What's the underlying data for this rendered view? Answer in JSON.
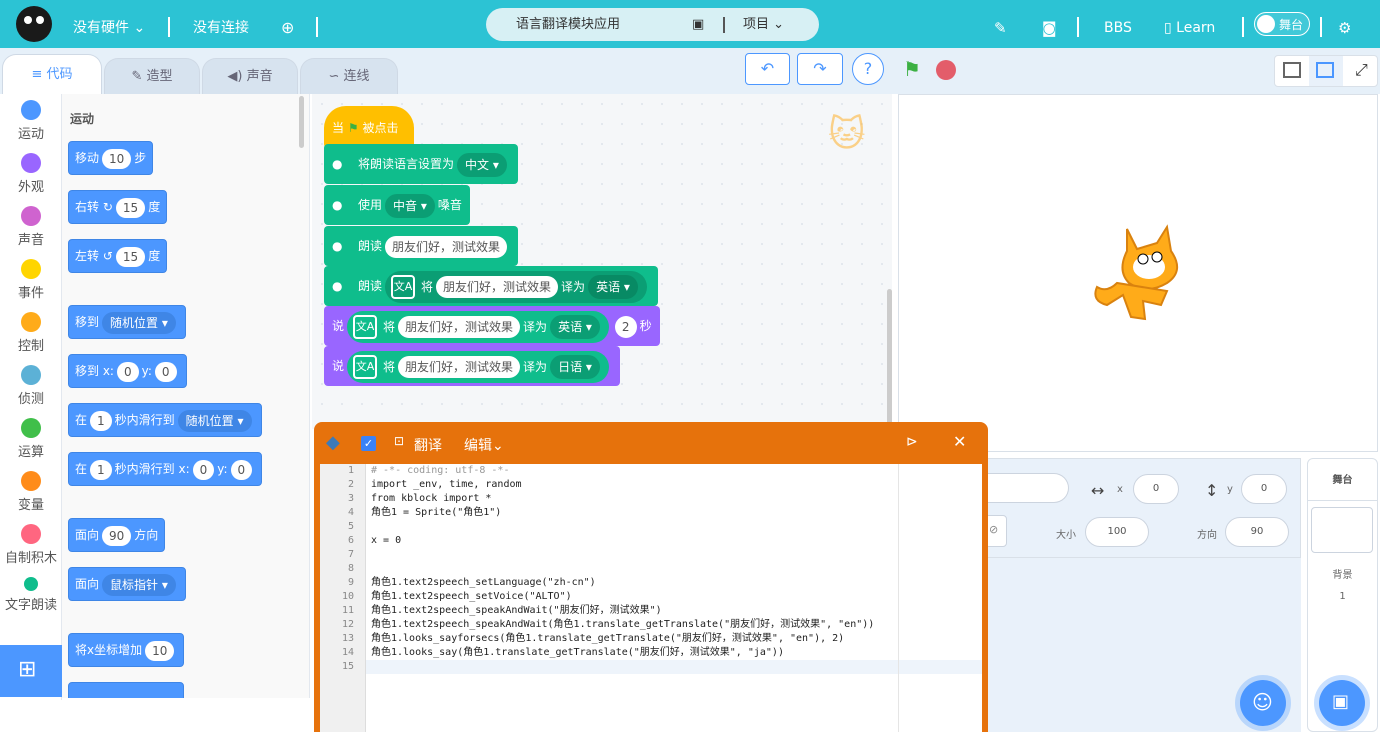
{
  "topbar": {
    "hardware": "没有硬件",
    "connection": "没有连接",
    "project_name": "语言翻译模块应用",
    "project_menu": "项目",
    "bbs": "BBS",
    "learn": "Learn",
    "stage_toggle": "舞台"
  },
  "tabs": [
    "代码",
    "造型",
    "声音",
    "连线"
  ],
  "categories": [
    {
      "label": "运动",
      "color": "#4c97ff"
    },
    {
      "label": "外观",
      "color": "#9966ff"
    },
    {
      "label": "声音",
      "color": "#cf63cf"
    },
    {
      "label": "事件",
      "color": "#ffd500"
    },
    {
      "label": "控制",
      "color": "#ffab19"
    },
    {
      "label": "侦测",
      "color": "#5cb1d6"
    },
    {
      "label": "运算",
      "color": "#40bf4a"
    },
    {
      "label": "变量",
      "color": "#ff8c1a"
    },
    {
      "label": "自制积木",
      "color": "#ff6680"
    },
    {
      "label": "文字朗读",
      "color": "#0fbd8c"
    }
  ],
  "palette": {
    "heading": "运动",
    "move": {
      "a": "移动",
      "v": "10",
      "b": "步"
    },
    "turn_right": {
      "a": "右转",
      "v": "15",
      "b": "度"
    },
    "turn_left": {
      "a": "左转",
      "v": "15",
      "b": "度"
    },
    "goto": {
      "a": "移到",
      "d": "随机位置"
    },
    "goto_xy": {
      "a": "移到 x:",
      "x": "0",
      "b": "y:",
      "y": "0"
    },
    "glide": {
      "a": "在",
      "v": "1",
      "b": "秒内滑行到",
      "d": "随机位置"
    },
    "glide_xy": {
      "a": "在",
      "v": "1",
      "b": "秒内滑行到 x:",
      "x": "0",
      "c": "y:",
      "y": "0"
    },
    "point": {
      "a": "面向",
      "v": "90",
      "b": "方向"
    },
    "point_towards": {
      "a": "面向",
      "d": "鼠标指针"
    },
    "change_x": {
      "a": "将x坐标增加",
      "v": "10"
    }
  },
  "script": {
    "hat": {
      "a": "当",
      "b": "被点击"
    },
    "set_lang": {
      "a": "将朗读语言设置为",
      "d": "中文"
    },
    "set_voice": {
      "a": "使用",
      "d": "中音",
      "b": "嗓音"
    },
    "speak": {
      "a": "朗读",
      "v": "朋友们好，测试效果"
    },
    "speak_tr": {
      "a": "朗读",
      "b": "将",
      "v": "朋友们好，测试效果",
      "c": "译为",
      "d": "英语"
    },
    "say_for": {
      "a": "说",
      "b": "将",
      "v": "朋友们好，测试效果",
      "c": "译为",
      "d": "英语",
      "n": "2",
      "e": "秒"
    },
    "say": {
      "a": "说",
      "b": "将",
      "v": "朋友们好，测试效果",
      "c": "译为",
      "d": "日语"
    }
  },
  "python": {
    "title": "翻译",
    "edit": "编辑",
    "lines": [
      "# -*- coding: utf-8 -*-",
      "import _env, time, random",
      "from kblock import *",
      "角色1 = Sprite(\"角色1\")",
      "",
      "x = 0",
      "",
      "",
      "角色1.text2speech_setLanguage(\"zh-cn\")",
      "角色1.text2speech_setVoice(\"ALTO\")",
      "角色1.text2speech_speakAndWait(\"朋友们好，测试效果\")",
      "角色1.text2speech_speakAndWait(角色1.translate_getTranslate(\"朋友们好，测试效果\", \"en\"))",
      "角色1.looks_sayforsecs(角色1.translate_getTranslate(\"朋友们好，测试效果\", \"en\"), 2)",
      "角色1.looks_say(角色1.translate_getTranslate(\"朋友们好，测试效果\", \"ja\"))",
      ""
    ]
  },
  "sprite_info": {
    "x_label": "x",
    "x": "0",
    "y_label": "y",
    "y": "0",
    "size_label": "大小",
    "size": "100",
    "dir_label": "方向",
    "dir": "90"
  },
  "stage_panel": {
    "title": "舞台",
    "backdrop_label": "背景",
    "backdrop_count": "1"
  }
}
